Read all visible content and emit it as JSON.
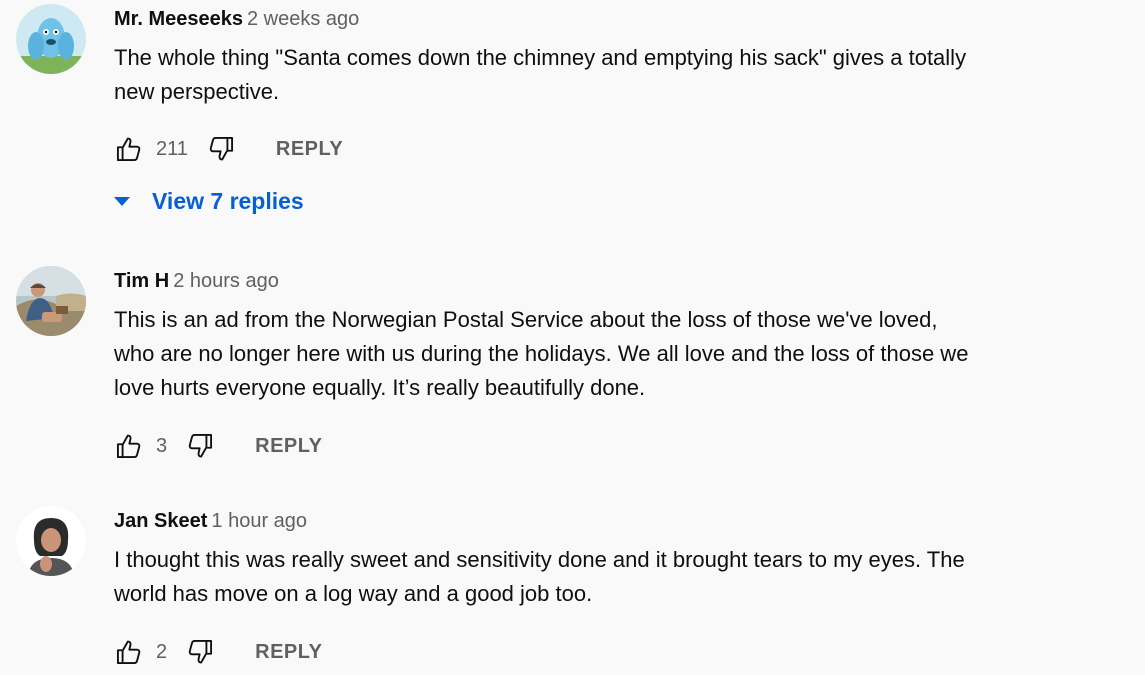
{
  "comments": [
    {
      "author": "Mr. Meeseeks",
      "time": "2 weeks ago",
      "text_lines": [
        "The whole thing \"Santa comes down the chimney and emptying his sack\" gives  a totally",
        "new perspective."
      ],
      "likes": "211",
      "reply_label": "REPLY",
      "avatar_icon": "meeseeks-avatar",
      "view_replies_label": "View 7 replies"
    },
    {
      "author": "Tim H",
      "time": "2 hours ago",
      "text_lines": [
        "This is an ad from the Norwegian Postal Service about the loss of those we've loved,",
        "who are no longer here with us during the holidays. We all love and the loss of those we",
        "love hurts everyone equally. It’s really beautifully done."
      ],
      "likes": "3",
      "reply_label": "REPLY",
      "avatar_icon": "photo-avatar"
    },
    {
      "author": "Jan Skeet",
      "time": "1 hour ago",
      "text_lines": [
        "I thought this was really sweet and sensitivity done and it brought tears to my eyes. The",
        "world has move on a log way and a good job too."
      ],
      "likes": "2",
      "reply_label": "REPLY",
      "avatar_icon": "photo-avatar"
    }
  ],
  "icons": {
    "like": "thumbs-up-icon",
    "dislike": "thumbs-down-icon",
    "expand": "caret-down-icon"
  },
  "colors": {
    "background": "#f9f9f9",
    "link": "#065fd4",
    "secondary_text": "#606060",
    "primary_text": "#0f0f0f"
  }
}
